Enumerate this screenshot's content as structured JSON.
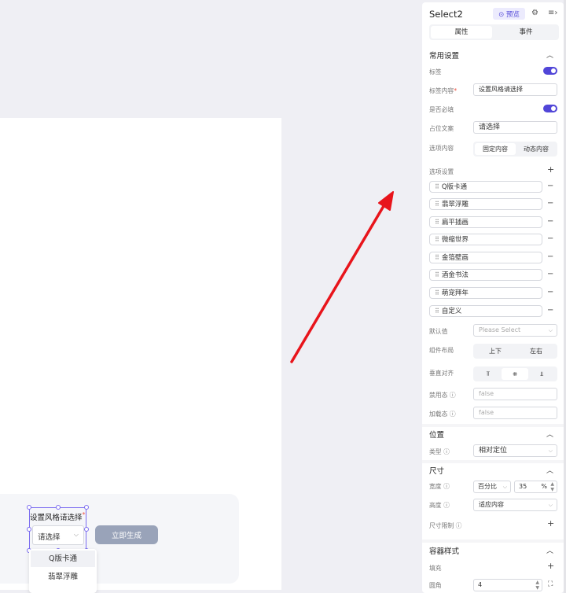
{
  "canvas": {
    "select_label": "设置风格请选择",
    "select_required_mark": "*",
    "select_value": "请选择",
    "generate_button": "立即生成",
    "dropdown_options": [
      "Q版卡通",
      "翡翠浮雕"
    ]
  },
  "panel": {
    "title": "Select2",
    "preview_button": "预览",
    "tabs": [
      "属性",
      "事件"
    ],
    "common_section": "常用设置",
    "fields": {
      "label": "标签",
      "label_content": "标签内容",
      "label_content_value": "设置风格请选择",
      "required": "是否必填",
      "placeholder": "占位文案",
      "placeholder_value": "请选择",
      "options_content": "选项内容",
      "options_content_seg": [
        "固定内容",
        "动态内容"
      ],
      "options_setting": "选项设置",
      "options": [
        "Q版卡通",
        "翡翠浮雕",
        "扁平插画",
        "微缩世界",
        "金箔壁画",
        "酒金书法",
        "萌宠拜年",
        "自定义"
      ],
      "default_value": "默认值",
      "default_placeholder": "Please Select",
      "layout": "组件布局",
      "layout_seg": [
        "上下",
        "左右"
      ],
      "vertical_align": "垂直对齐",
      "disabled": "禁用态",
      "disabled_value": "false",
      "loading": "加载态",
      "loading_value": "false"
    },
    "position_section": "位置",
    "position_type_label": "类型",
    "position_type_value": "相对定位",
    "size_section": "尺寸",
    "width_label": "宽度",
    "width_unit": "百分比",
    "width_value": "35",
    "width_suffix": "%",
    "height_label": "高度",
    "height_value": "适应内容",
    "size_limit_label": "尺寸限制",
    "container_section": "容器样式",
    "fill_label": "填充",
    "radius_label": "圆角",
    "radius_value": "4"
  },
  "colors": {
    "accent": "#5146d8",
    "selection": "#7b6cf0",
    "arrow": "#e8141b",
    "generate_button": "#99a3b9"
  }
}
